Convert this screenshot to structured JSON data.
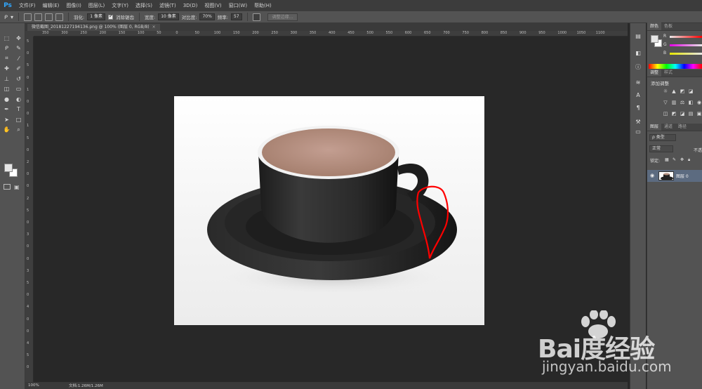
{
  "app": {
    "logo": "Ps"
  },
  "menu": [
    "文件(F)",
    "编辑(E)",
    "图像(I)",
    "图层(L)",
    "文字(Y)",
    "选择(S)",
    "滤镜(T)",
    "3D(D)",
    "视图(V)",
    "窗口(W)",
    "帮助(H)"
  ],
  "options": {
    "feather_label": "羽化:",
    "feather_value": "1 像素",
    "antialias_label": "消除锯齿",
    "width_label": "宽度:",
    "width_value": "10 像素",
    "contrast_label": "对比度:",
    "contrast_value": "70%",
    "frequency_label": "频率:",
    "frequency_value": "57",
    "refine_edge_label": "调整边缘..."
  },
  "document": {
    "tab_title": "微信截图_20181227194136.png @ 100% (图层 0, RGB/8)",
    "tab_close": "×"
  },
  "ruler": {
    "top": [
      "350",
      "300",
      "250",
      "200",
      "150",
      "100",
      "50",
      "0",
      "50",
      "100",
      "150",
      "200",
      "250",
      "300",
      "350",
      "400",
      "450",
      "500",
      "550",
      "600",
      "650",
      "700",
      "750",
      "800",
      "850",
      "900",
      "950",
      "1000",
      "1050",
      "1100"
    ],
    "left": [
      "5",
      "0",
      "5",
      "0",
      "1",
      "0",
      "0",
      "1",
      "5",
      "0",
      "2",
      "0",
      "0",
      "2",
      "5",
      "0",
      "3",
      "0",
      "0",
      "3",
      "5",
      "0",
      "4",
      "0",
      "0",
      "4",
      "5",
      "0"
    ]
  },
  "status": {
    "zoom": "100%",
    "doc": "文档:1.26M/1.26M"
  },
  "panels": {
    "color_tabs": [
      "颜色",
      "色板"
    ],
    "color_channels": [
      "R",
      "G",
      "B"
    ],
    "adjust_tabs": [
      "调整",
      "样式"
    ],
    "adjust_title": "添加调整",
    "layers_tabs": [
      "图层",
      "通道",
      "路径"
    ],
    "kind_select": "ρ 类型",
    "blend_mode": "正常",
    "opacity_label": "不透",
    "lock_label": "锁定:",
    "layer_name": "图层 0"
  },
  "colors": {
    "accent": "#31a8ff",
    "annotation_red": "#ff0000",
    "selected_layer": "#5c6b80"
  },
  "watermark": {
    "brand": "Bai度经验",
    "url": "jingyan.baidu.com"
  }
}
